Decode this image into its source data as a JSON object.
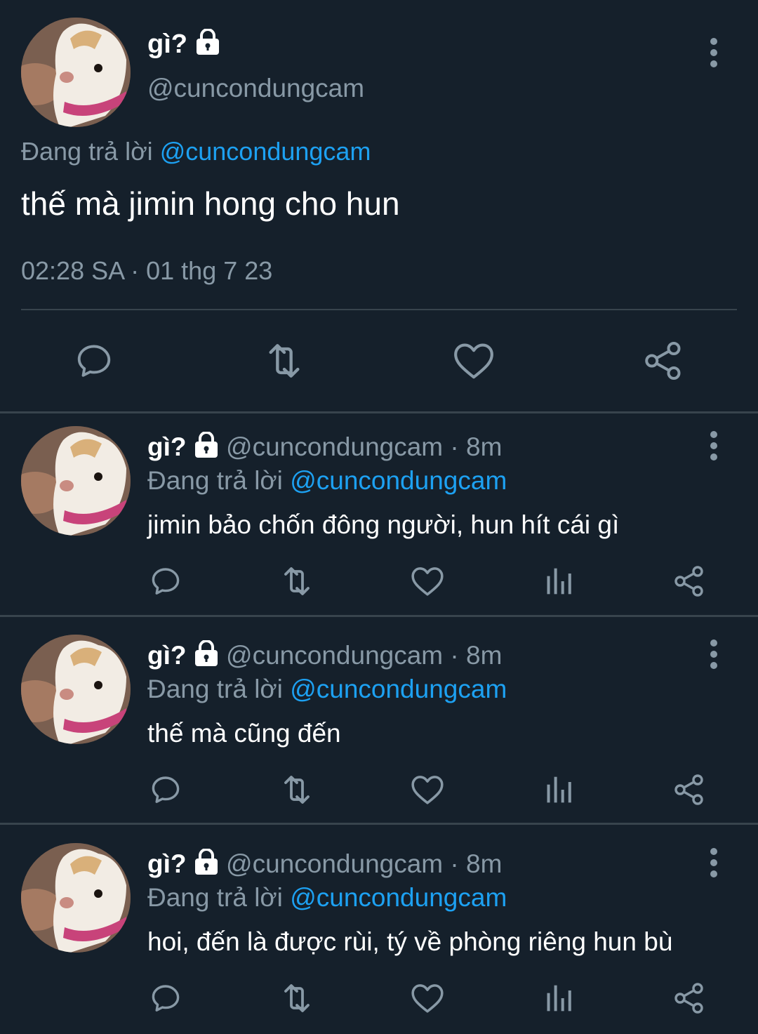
{
  "colors": {
    "background": "#15202b",
    "text_primary": "#ffffff",
    "text_secondary": "#8899a6",
    "accent": "#1da1f2",
    "divider": "#38444d"
  },
  "main_tweet": {
    "display_name": "gì?",
    "handle": "@cuncondungcam",
    "replying_prefix": "Đang trả lời",
    "replying_to": "@cuncondungcam",
    "text": "thế mà jimin hong cho hun",
    "timestamp": "02:28 SA · 01 thg 7 23",
    "actions": [
      "reply-icon",
      "retweet-icon",
      "like-icon",
      "share-icon"
    ]
  },
  "replies": [
    {
      "display_name": "gì?",
      "handle": "@cuncondungcam",
      "time": " · 8m",
      "replying_prefix": "Đang trả lời",
      "replying_to": "@cuncondungcam",
      "text": "jimin bảo chốn đông người, hun hít cái gì"
    },
    {
      "display_name": "gì?",
      "handle": "@cuncondungcam",
      "time": " · 8m",
      "replying_prefix": "Đang trả lời",
      "replying_to": "@cuncondungcam",
      "text": "thế mà cũng đến"
    },
    {
      "display_name": "gì?",
      "handle": "@cuncondungcam",
      "time": " · 8m",
      "replying_prefix": "Đang trả lời",
      "replying_to": "@cuncondungcam",
      "text": "hoi, đến là được rùi, tý về phòng riêng hun bù"
    }
  ],
  "icons": {
    "lock": "lock-icon",
    "more": "more-vertical-icon",
    "reply": "reply-icon",
    "retweet": "retweet-icon",
    "like": "like-icon",
    "analytics": "analytics-icon",
    "share": "share-icon"
  }
}
